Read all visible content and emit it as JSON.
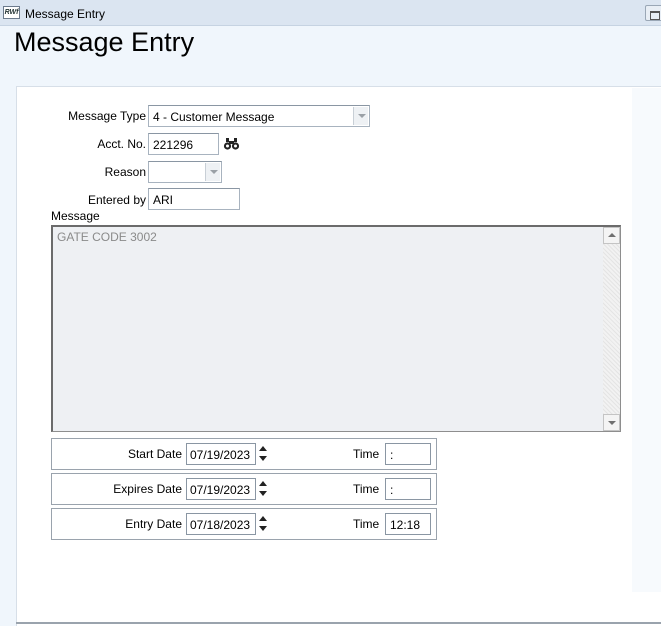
{
  "window": {
    "title": "Message Entry",
    "icon_name": "app-logo-icon",
    "icon_text": "RWf"
  },
  "page": {
    "title": "Message Entry"
  },
  "form": {
    "message_type": {
      "label": "Message Type",
      "value": "4 - Customer Message"
    },
    "acct_no": {
      "label": "Acct. No.",
      "value": "221296",
      "lookup_icon": "binoculars-icon"
    },
    "reason": {
      "label": "Reason",
      "value": ""
    },
    "entered_by": {
      "label": "Entered by",
      "value": "ARI"
    },
    "message": {
      "label": "Message",
      "value": "GATE CODE 3002"
    }
  },
  "dates": {
    "start": {
      "label": "Start Date",
      "date": "07/19/2023",
      "time_label": "Time",
      "time": " :"
    },
    "expires": {
      "label": "Expires Date",
      "date": "07/19/2023",
      "time_label": "Time",
      "time": " :"
    },
    "entry": {
      "label": "Entry Date",
      "date": "07/18/2023",
      "time_label": "Time",
      "time": "12:18"
    }
  }
}
